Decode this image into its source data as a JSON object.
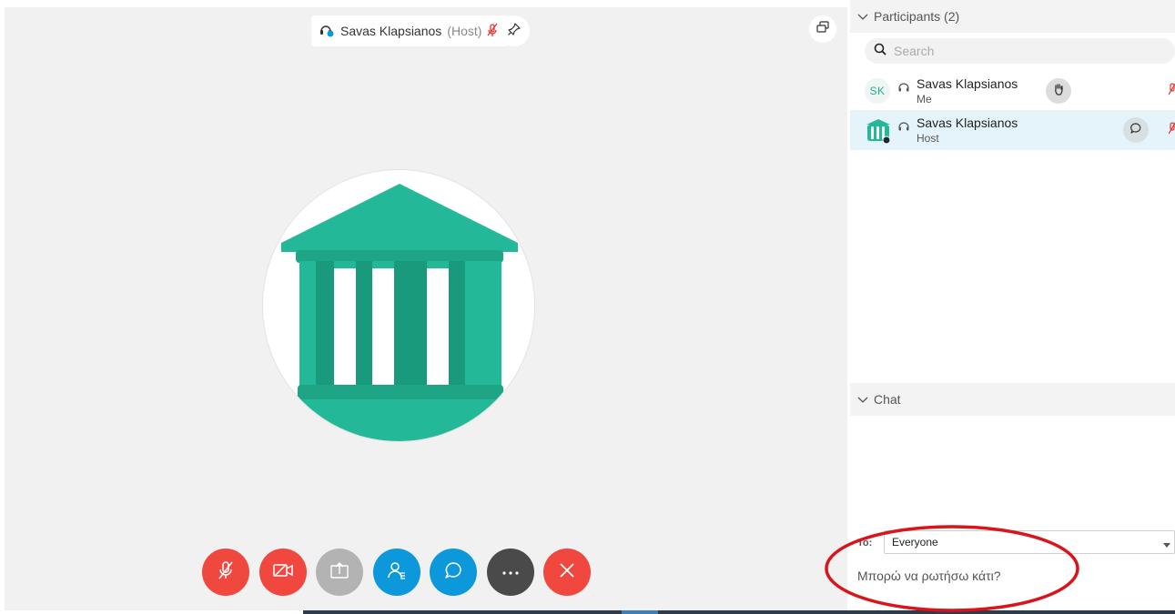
{
  "stage": {
    "host_name": "Savas Klapsianos",
    "host_role": "(Host)"
  },
  "controls": [
    {
      "name": "mute",
      "icon": "mic-off-icon",
      "color": "#f0473f"
    },
    {
      "name": "video",
      "icon": "video-off-icon",
      "color": "#f0473f"
    },
    {
      "name": "share",
      "icon": "share-icon",
      "color": "#b3b3b3"
    },
    {
      "name": "participants",
      "icon": "participants-icon",
      "color": "#0d98db"
    },
    {
      "name": "chat",
      "icon": "chat-icon",
      "color": "#0d98db"
    },
    {
      "name": "more",
      "icon": "more-icon",
      "color": "#4a4a4a"
    },
    {
      "name": "leave",
      "icon": "close-icon",
      "color": "#f0473f"
    }
  ],
  "participants": {
    "header": "Participants (2)",
    "search_placeholder": "Search",
    "items": [
      {
        "initials": "SK",
        "name": "Savas Klapsianos",
        "subtitle": "Me"
      },
      {
        "initials": "",
        "name": "Savas Klapsianos",
        "subtitle": "Host"
      }
    ]
  },
  "chat": {
    "header": "Chat",
    "to_label": "To:",
    "to_value": "Everyone",
    "message": "Μπορώ να ρωτήσω κάτι?"
  },
  "colors": {
    "accent_teal": "#22b28f",
    "control_red": "#f0473f",
    "control_blue": "#0d98db",
    "annotation_red": "#d9141b"
  }
}
